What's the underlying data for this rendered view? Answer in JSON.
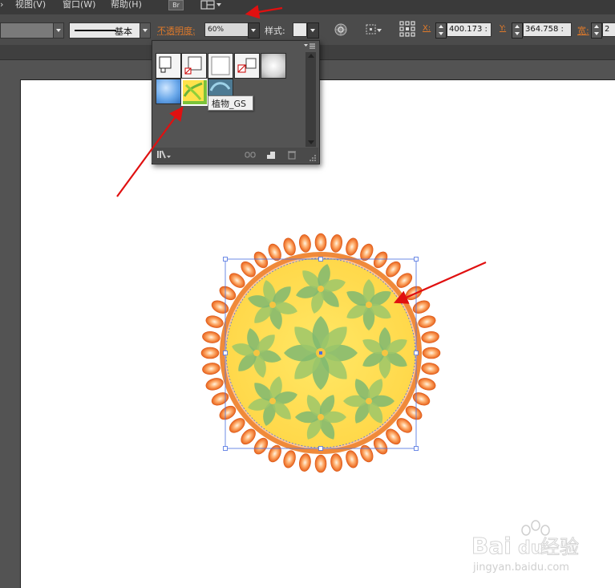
{
  "menubar": {
    "items": [
      "视图(V)",
      "窗口(W)",
      "帮助(H)"
    ],
    "br_label": "Br"
  },
  "control_bar": {
    "stroke_profile": "基本",
    "opacity_label": "不透明度:",
    "opacity_value": "60%",
    "style_label": "样式:",
    "x_label": "X:",
    "x_value": "400.173 :",
    "y_label": "Y:",
    "y_value": "364.758 :",
    "w_label": "宽:",
    "w_value": "2"
  },
  "styles_panel": {
    "tooltip": "植物_GS"
  },
  "watermark": {
    "brand": "Bai",
    "brand2": "du",
    "product": "经验",
    "url": "jingyan.baidu.com"
  },
  "colors": {
    "accent_orange": "#e07a2a",
    "arrow_red": "#e01010",
    "selection_blue": "#4a6fe0"
  }
}
